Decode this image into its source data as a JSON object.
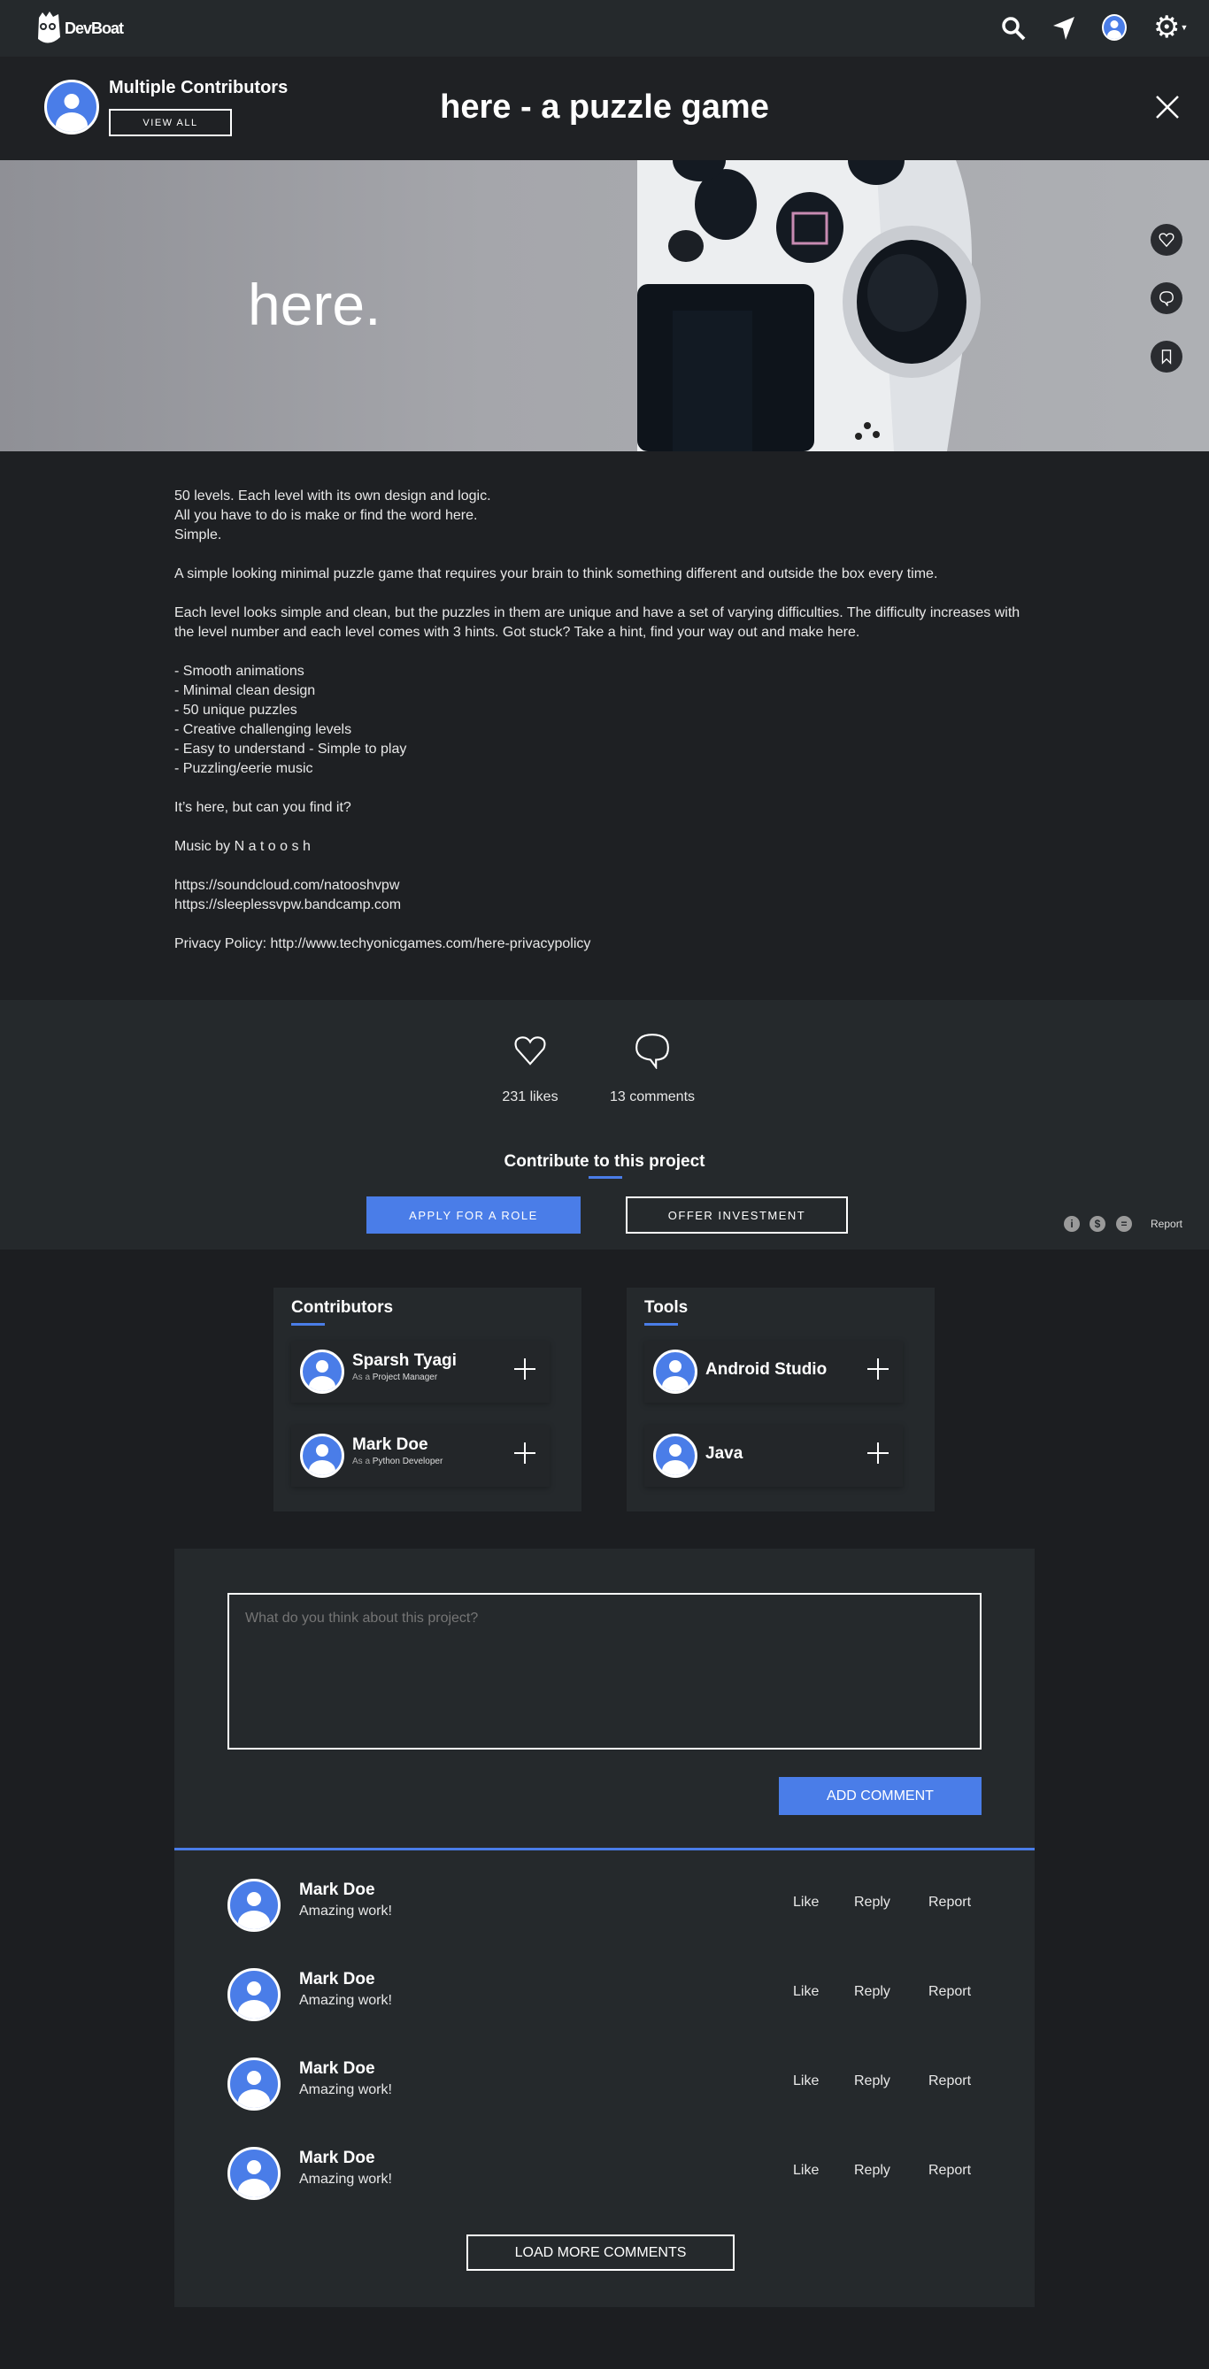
{
  "nav": {
    "brand": "DevBoat",
    "icons": [
      "search-icon",
      "send-icon",
      "user-icon",
      "gear-icon"
    ]
  },
  "header": {
    "contributors_label": "Multiple Contributors",
    "view_all": "VIEW ALL",
    "title": "here - a puzzle game"
  },
  "hero": {
    "text": "here.",
    "side_actions": [
      "heart-icon",
      "comment-icon",
      "bookmark-icon"
    ]
  },
  "description": "50 levels. Each level with its own design and logic.\nAll you have to do is make or find the word here.\nSimple.\n\nA simple looking minimal puzzle game that requires your brain to think something different and outside the box every time.\n\nEach level looks simple and clean, but the puzzles in them are unique and have a set of varying difficulties. The difficulty increases with the level number and each level comes with 3 hints. Got stuck? Take a hint, find your way out and make here.\n\n- Smooth animations\n- Minimal clean design\n- 50 unique puzzles\n- Creative challenging levels\n- Easy to understand - Simple to play\n- Puzzling/eerie music\n\nIt’s here, but can you find it?\n\nMusic by N a t o o s h\n\nhttps://soundcloud.com/natooshvpw\nhttps://sleeplessvpw.bandcamp.com\n\nPrivacy Policy: http://www.techyonicgames.com/here-privacypolicy",
  "stats": {
    "likes": "231 likes",
    "comments": "13 comments"
  },
  "contribute": {
    "title": "Contribute to this project",
    "apply": "APPLY FOR A ROLE",
    "invest": "OFFER INVESTMENT",
    "report": "Report"
  },
  "contributors": {
    "title": "Contributors",
    "items": [
      {
        "name": "Sparsh Tyagi",
        "prefix": "As a",
        "role": "Project Manager"
      },
      {
        "name": "Mark Doe",
        "prefix": "As a",
        "role": "Python Developer"
      }
    ]
  },
  "tools": {
    "title": "Tools",
    "items": [
      {
        "name": "Android Studio"
      },
      {
        "name": "Java"
      }
    ]
  },
  "comment_form": {
    "placeholder": "What do you think about this project?",
    "submit": "ADD COMMENT"
  },
  "comments": [
    {
      "name": "Mark Doe",
      "text": "Amazing work!",
      "like": "Like",
      "reply": "Reply",
      "report": "Report"
    },
    {
      "name": "Mark Doe",
      "text": "Amazing work!",
      "like": "Like",
      "reply": "Reply",
      "report": "Report"
    },
    {
      "name": "Mark Doe",
      "text": "Amazing work!",
      "like": "Like",
      "reply": "Reply",
      "report": "Report"
    },
    {
      "name": "Mark Doe",
      "text": "Amazing work!",
      "like": "Like",
      "reply": "Reply",
      "report": "Report"
    }
  ],
  "load_more": "LOAD MORE COMMENTS",
  "colors": {
    "accent": "#4a7de8",
    "nav_bg": "#25292c",
    "page_bg": "#1c1e21"
  }
}
